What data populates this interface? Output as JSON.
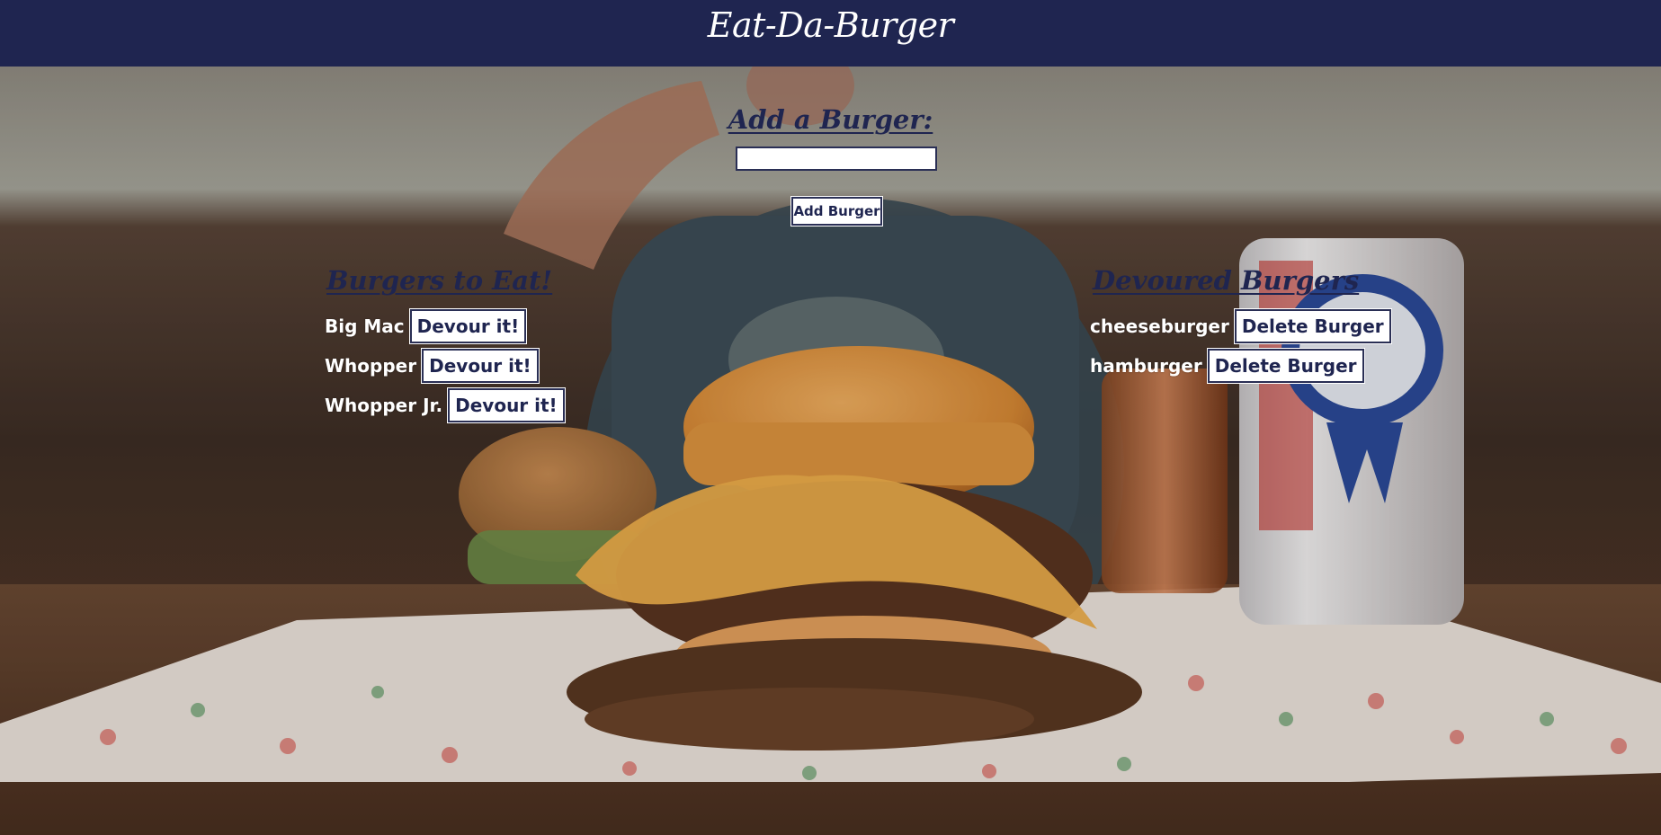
{
  "header": {
    "title": "Eat-Da-Burger"
  },
  "add_form": {
    "heading": "Add a Burger:",
    "input_value": "",
    "input_placeholder": "",
    "button_label": "Add Burger"
  },
  "to_eat": {
    "heading": "Burgers to Eat!",
    "items": [
      {
        "name": "Big Mac",
        "button_label": "Devour it!"
      },
      {
        "name": "Whopper",
        "button_label": "Devour it!"
      },
      {
        "name": "Whopper Jr.",
        "button_label": "Devour it!"
      }
    ]
  },
  "devoured": {
    "heading": "Devoured Burgers",
    "items": [
      {
        "name": "cheeseburger",
        "button_label": "Delete Burger"
      },
      {
        "name": "hamburger",
        "button_label": "Delete Burger"
      }
    ]
  },
  "colors": {
    "header_bg": "#1f2550",
    "accent": "#1f2550",
    "button_border": "#2a2f55"
  }
}
